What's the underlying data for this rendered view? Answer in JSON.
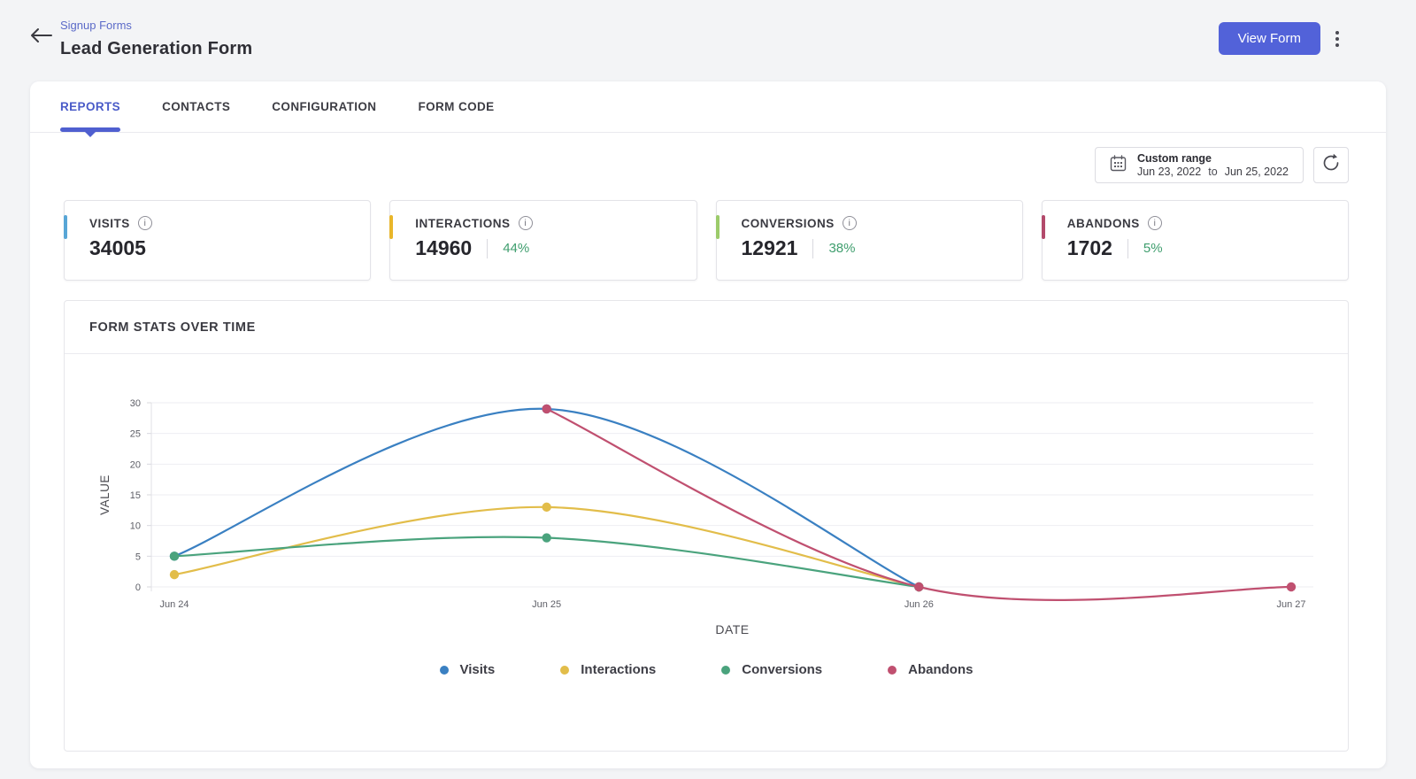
{
  "header": {
    "breadcrumb": "Signup Forms",
    "title": "Lead Generation Form",
    "view_form_label": "View Form"
  },
  "tabs": [
    {
      "label": "REPORTS",
      "active": true
    },
    {
      "label": "CONTACTS",
      "active": false
    },
    {
      "label": "CONFIGURATION",
      "active": false
    },
    {
      "label": "FORM CODE",
      "active": false
    }
  ],
  "toolbar": {
    "range_label": "Custom range",
    "range_start": "Jun 23, 2022",
    "range_to": "to",
    "range_end": "Jun 25, 2022"
  },
  "stats": [
    {
      "label": "VISITS",
      "value": "34005",
      "percent": null,
      "accent": "#58a6d6"
    },
    {
      "label": "INTERACTIONS",
      "value": "14960",
      "percent": "44%",
      "accent": "#e9b62a"
    },
    {
      "label": "CONVERSIONS",
      "value": "12921",
      "percent": "38%",
      "accent": "#9ccb6a"
    },
    {
      "label": "ABANDONS",
      "value": "1702",
      "percent": "5%",
      "accent": "#b34a6b"
    }
  ],
  "chart_data": {
    "type": "line",
    "title": "FORM STATS OVER TIME",
    "categories": [
      "Jun 24",
      "Jun 25",
      "Jun 26",
      "Jun 27"
    ],
    "series": [
      {
        "name": "Visits",
        "color": "#3a80c2",
        "values": [
          5,
          29,
          0,
          null
        ]
      },
      {
        "name": "Interactions",
        "color": "#e2bd4a",
        "values": [
          2,
          13,
          0,
          null
        ]
      },
      {
        "name": "Conversions",
        "color": "#4aa37d",
        "values": [
          5,
          8,
          0,
          null
        ]
      },
      {
        "name": "Abandons",
        "color": "#c05070",
        "values": [
          null,
          29,
          0,
          0
        ]
      }
    ],
    "xlabel": "DATE",
    "ylabel": "VALUE",
    "ylim": [
      0,
      30
    ],
    "yticks": [
      0,
      5,
      10,
      15,
      20,
      25,
      30
    ],
    "grid": true,
    "legend_position": "bottom"
  },
  "icons": {
    "info_glyph": "i",
    "back": "arrow-left",
    "calendar": "calendar",
    "refresh": "circular-arrow",
    "menu": "vertical-kebab"
  }
}
